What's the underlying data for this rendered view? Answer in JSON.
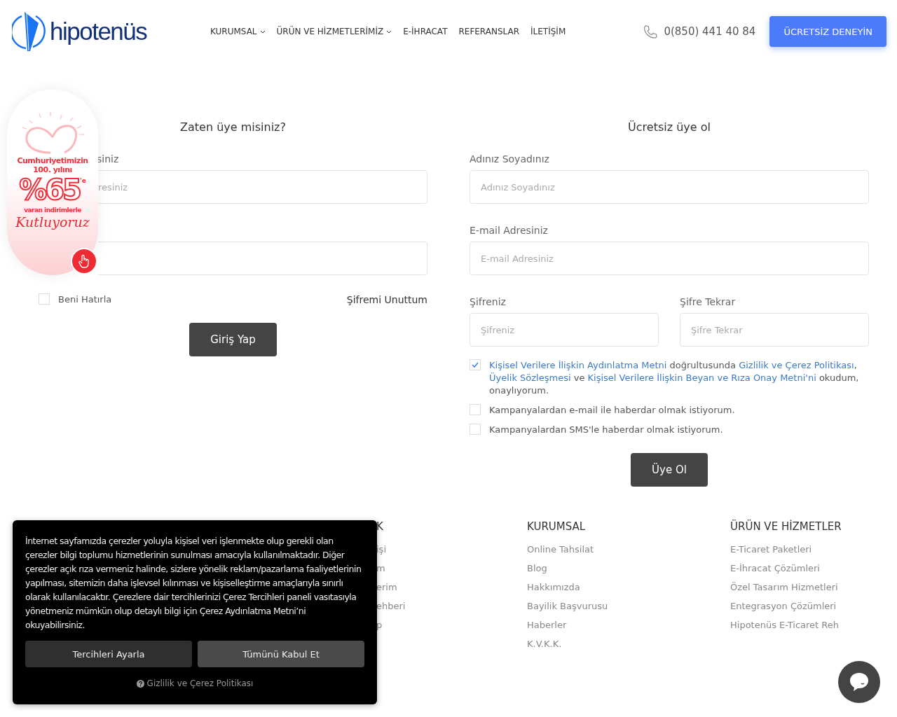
{
  "header": {
    "logo": "hipotenüs",
    "nav": [
      {
        "label": "KURUMSAL",
        "dropdown": true
      },
      {
        "label": "ÜRÜN VE HİZMETLERİMİZ",
        "dropdown": true
      },
      {
        "label": "E-İHRACAT",
        "dropdown": false
      },
      {
        "label": "REFERANSLAR",
        "dropdown": false
      },
      {
        "label": "İLETİŞİM",
        "dropdown": false
      }
    ],
    "phone": "0(850) 441 40 84",
    "cta": "ÜCRETSİZ DENEYİN"
  },
  "login": {
    "title": "Zaten üye misiniz?",
    "fields": [
      {
        "label": "siniz",
        "placeholder": "resiniz"
      }
    ],
    "remember": {
      "label": "Beni Hatırla",
      "checked": false
    },
    "forgot": "Şifremi Unuttum",
    "submit": "Giriş Yap"
  },
  "register": {
    "title": "Ücretsiz üye ol",
    "rows": [
      [
        {
          "label": "Adınız Soyadınız",
          "placeholder": "Adınız Soyadınız"
        }
      ],
      [
        {
          "label": "E-mail Adresiniz",
          "placeholder": "E-mail Adresiniz"
        }
      ],
      [
        {
          "label": "Şifreniz",
          "placeholder": "Şifreniz"
        },
        {
          "label": "Şifre Tekrar",
          "placeholder": "Şifre Tekrar"
        }
      ]
    ],
    "consent": {
      "checked": true,
      "segments": [
        {
          "text": "Kişisel Verilere İlişkin Aydınlatma Metni",
          "link": true
        },
        {
          "text": " doğrultusunda ",
          "link": false
        },
        {
          "text": "Gizlilik ve Çerez Politikası",
          "link": true
        },
        {
          "text": ", ",
          "link": false
        },
        {
          "text": "Üyelik Sözleşmesi",
          "link": true
        },
        {
          "text": " ve ",
          "link": false
        },
        {
          "text": "Kişisel Verilere İlişkin Beyan ve Rıza Onay Metni'ni",
          "link": true
        },
        {
          "text": " okudum, onaylıyorum.",
          "link": false
        }
      ]
    },
    "options": [
      {
        "label": "Kampanyalardan e-mail ile haberdar olmak istiyorum.",
        "checked": false
      },
      {
        "label": "Kampanyalardan SMS'le haberdar olmak istiyorum.",
        "checked": false
      }
    ],
    "submit": "Üye Ol"
  },
  "badge": {
    "line1": "Cumhuriyetimizin",
    "line2": "100. yılını",
    "percent": "%65",
    "suffix": "'e",
    "line3": "varan indirimlerle",
    "line4": "Kutluyoruz"
  },
  "footer": {
    "columns": [
      {
        "heading": "K",
        "links": [
          "işi",
          "m",
          "erim",
          "ehberi",
          "p"
        ]
      },
      {
        "heading": "KURUMSAL",
        "links": [
          "Online Tahsilat",
          "Blog",
          "Hakkımızda",
          "Bayilik Başvurusu",
          "Haberler",
          "K.V.K.K."
        ]
      },
      {
        "heading": "ÜRÜN VE HİZMETLER",
        "links": [
          "E-Ticaret Paketleri",
          "E-İhracat Çözümleri",
          "Özel Tasarım Hizmetleri",
          "Entegrasyon Çözümleri",
          "Hipotenüs E-Ticaret Reh"
        ]
      }
    ]
  },
  "cookie": {
    "text": "İnternet sayfamızda çerezler yoluyla kişisel veri işlenmekte olup gerekli olan çerezler bilgi toplumu hizmetlerinin sunulması amacıyla kullanılmaktadır. Diğer çerezler açık rıza vermeniz halinde, sizlere yönelik reklam/pazarlama faaliyetlerinin yapılması, sitemizin daha işlevsel kılınması ve kişiselleştirme amaçlarıyla sınırlı olarak kullanılacaktır. Çerezlere dair tercihlerinizi Çerez Tercihleri paneli vasıtasıyla yönetmeniz mümkün olup detaylı bilgi için Çerez Aydınlatma Metni’ni okuyabilirsiniz.",
    "buttons": [
      {
        "label": "Tercihleri Ayarla",
        "kind": "secondary"
      },
      {
        "label": "Tümünü Kabul Et",
        "kind": "primary"
      }
    ],
    "policy": "Gizlilik ve Çerez Politikası"
  }
}
